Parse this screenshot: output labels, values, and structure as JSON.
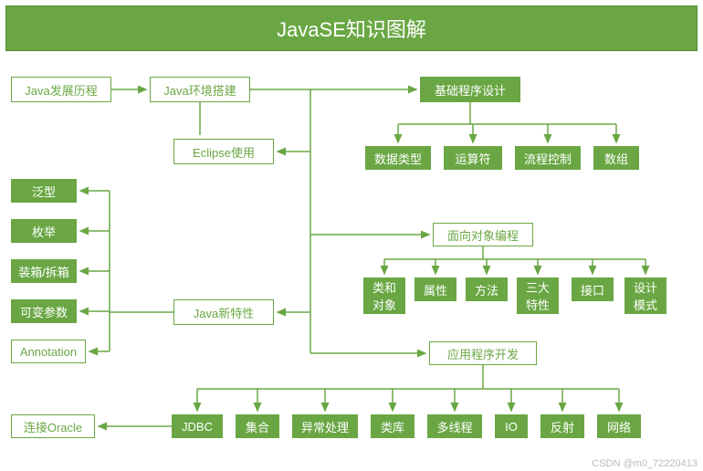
{
  "title": "JavaSE知识图解",
  "nodes": {
    "history": "Java发展历程",
    "env": "Java环境搭建",
    "basic": "基础程序设计",
    "eclipse": "Eclipse使用",
    "dtype": "数据类型",
    "operator": "运算符",
    "flow": "流程控制",
    "array": "数组",
    "generic": "泛型",
    "enum": "枚举",
    "boxing": "装箱/拆箱",
    "varargs": "可变参数",
    "annotation": "Annotation",
    "newfeat": "Java新特性",
    "oop": "面向对象编程",
    "classobj": "类和\n对象",
    "attr": "属性",
    "method": "方法",
    "three": "三大\n特性",
    "interface": "接口",
    "design": "设计\n模式",
    "appdev": "应用程序开发",
    "oracle": "连接Oracle",
    "jdbc": "JDBC",
    "collection": "集合",
    "exception": "异常处理",
    "classlib": "类库",
    "thread": "多线程",
    "io": "IO",
    "reflect": "反射",
    "network": "网络"
  },
  "watermark": "CSDN @m0_72220413"
}
